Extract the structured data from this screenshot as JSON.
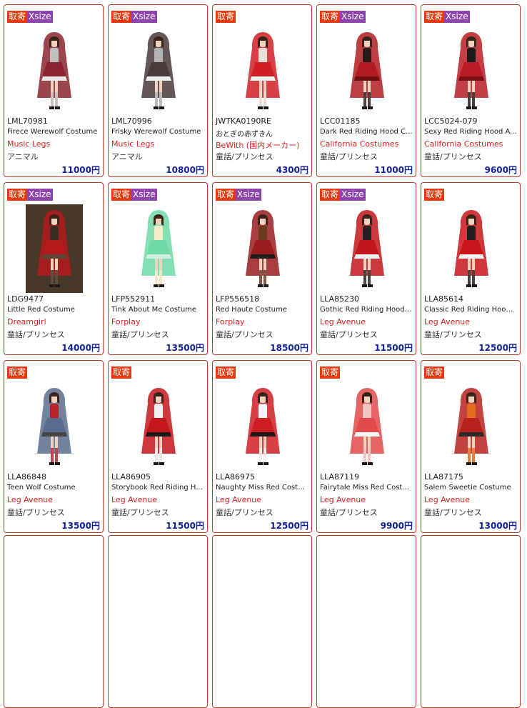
{
  "badges": {
    "tori": "取寄",
    "xsize": "Xsize"
  },
  "products": [
    {
      "code": "LML70981",
      "name": "Firece Werewolf Costume",
      "maker": "Music Legs",
      "category": "アニマル",
      "price": "11000円",
      "xsize": true,
      "palette": [
        "#8a2430",
        "#bfbfbf",
        "#e9e9e9"
      ]
    },
    {
      "code": "LML70996",
      "name": "Frisky Werewolf Costume",
      "maker": "Music Legs",
      "category": "アニマル",
      "price": "10800円",
      "xsize": true,
      "palette": [
        "#4a3a3a",
        "#b3b3b3",
        "#eeeeee"
      ]
    },
    {
      "code": "JWTKA0190RE",
      "name": "おとぎの赤ずきん",
      "maker": "BeWith (国内メーカー)",
      "category": "童話/プリンセス",
      "price": "4300円",
      "xsize": false,
      "palette": [
        "#d01e24",
        "#e8e0d8",
        "#f2f2f2"
      ]
    },
    {
      "code": "LCC01185",
      "name": "Dark Red Riding Hood C...",
      "maker": "California Costumes",
      "category": "童話/プリンセス",
      "price": "11000円",
      "xsize": true,
      "palette": [
        "#b11c22",
        "#2a1a1a",
        "#6e1014"
      ]
    },
    {
      "code": "LCC5024-079",
      "name": "Sexy Red Riding Hood A...",
      "maker": "California Costumes",
      "category": "童話/プリンセス",
      "price": "9600円",
      "xsize": true,
      "palette": [
        "#b81c24",
        "#1c1c1c",
        "#7a1218"
      ]
    },
    {
      "code": "LDG9477",
      "name": "Little Red Costume",
      "maker": "Dreamgirl",
      "category": "童話/プリンセス",
      "price": "14000円",
      "xsize": true,
      "palette": [
        "#b51a1f",
        "#3a2e22",
        "#5b4733"
      ],
      "photo": true
    },
    {
      "code": "LFP552911",
      "name": "Tink About Me Costume",
      "maker": "Forplay",
      "category": "童話/プリンセス",
      "price": "13500円",
      "xsize": true,
      "palette": [
        "#6fd9a8",
        "#f4ecc7",
        "#cfeee2"
      ]
    },
    {
      "code": "LFP556518",
      "name": "Red Haute Costume",
      "maker": "Forplay",
      "category": "童話/プリンセス",
      "price": "18500円",
      "xsize": true,
      "palette": [
        "#9a1c1e",
        "#6a3a1f",
        "#1e1e1e"
      ]
    },
    {
      "code": "LLA85230",
      "name": "Gothic Red Riding Hood ...",
      "maker": "Leg Avenue",
      "category": "童話/プリンセス",
      "price": "11500円",
      "xsize": true,
      "palette": [
        "#c0161c",
        "#222222",
        "#f1f1f1"
      ]
    },
    {
      "code": "LLA85614",
      "name": "Classic Red Riding Hood...",
      "maker": "Leg Avenue",
      "category": "童話/プリンセス",
      "price": "12500円",
      "xsize": false,
      "palette": [
        "#c8151c",
        "#1f1f1f",
        "#f3f3f3"
      ]
    },
    {
      "code": "LLA86848",
      "name": "Teen Wolf Costume",
      "maker": "Leg Avenue",
      "category": "童話/プリンセス",
      "price": "13500円",
      "xsize": false,
      "palette": [
        "#5a6c8c",
        "#b8232a",
        "#444444"
      ]
    },
    {
      "code": "LLA86905",
      "name": "Storybook Red Riding H...",
      "maker": "Leg Avenue",
      "category": "童話/プリンセス",
      "price": "11500円",
      "xsize": false,
      "palette": [
        "#c4161c",
        "#f0f0f0",
        "#1a1a1a"
      ]
    },
    {
      "code": "LLA86975",
      "name": "Naughty Miss Red Costu...",
      "maker": "Leg Avenue",
      "category": "童話/プリンセス",
      "price": "12500円",
      "xsize": false,
      "palette": [
        "#cf1d24",
        "#f5f5f5",
        "#1a1a1a"
      ]
    },
    {
      "code": "LLA87119",
      "name": "Fairytale Miss Red Cost...",
      "maker": "Leg Avenue",
      "category": "童話/プリンセス",
      "price": "9900円",
      "xsize": false,
      "palette": [
        "#e04a4a",
        "#f4c4c4",
        "#f9f9f9"
      ]
    },
    {
      "code": "LLA87175",
      "name": "Salem Sweetie Costume",
      "maker": "Leg Avenue",
      "category": "童話/プリンセス",
      "price": "13000円",
      "xsize": false,
      "palette": [
        "#b8221e",
        "#e66a1f",
        "#2a2a2a"
      ]
    }
  ]
}
